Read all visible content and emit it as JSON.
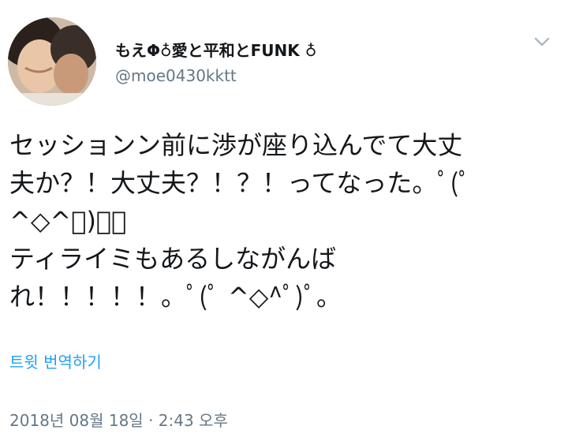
{
  "user": {
    "display_name": "もえΦ♁愛と平和とFUNK ♁",
    "handle": "@moe0430kktt"
  },
  "tweet": {
    "lines": [
      "セッションン前に渉が座り込んでて大丈",
      "夫か？！大丈夫？！？！ってなった。ﾟ(ﾟ",
      "^◇^ﾟ)ﾟ。",
      "ティライミもあるしながんば",
      "れ！！！！！。ﾟ(ﾟ ^◇^ﾟ)ﾟ。"
    ]
  },
  "translate_label": "트윗 번역하기",
  "timestamp": "2018년 08월 18일 · 2:43 오후",
  "icons": {
    "menu": "chevron-down-icon"
  },
  "colors": {
    "text": "#14171a",
    "secondary": "#657786",
    "link": "#1da1f2"
  }
}
